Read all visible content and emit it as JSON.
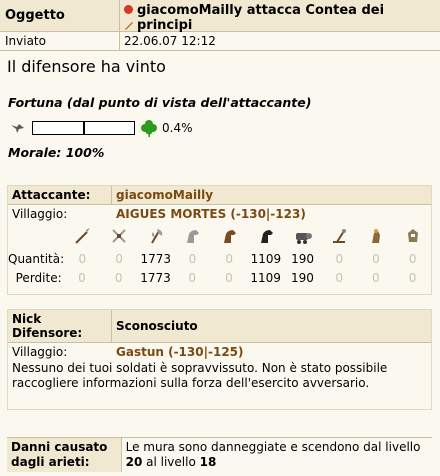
{
  "header": {
    "label_subject": "Oggetto",
    "subject": "giacomoMailly attacca Contea dei principi",
    "label_sent": "Inviato",
    "sent": "22.06.07 12:12"
  },
  "result_title": "Il difensore ha vinto",
  "fortune": {
    "title": "Fortuna (dal punto di vista dell'attaccante)",
    "value": 0.004,
    "percent_text": "0.4%"
  },
  "morale": "Morale: 100%",
  "attacker": {
    "label": "Attaccante:",
    "name": "giacomoMailly",
    "village_label": "Villaggio:",
    "village": "AIGUES MORTES (-130|-123)",
    "qty_label": "Quantità:",
    "losses_label": "Perdite:",
    "units": [
      "spear-icon",
      "sword-icon",
      "axe-icon",
      "scout-icon",
      "light-cavalry-icon",
      "heavy-cavalry-icon",
      "ram-icon",
      "catapult-icon",
      "snob-icon",
      "knight-icon"
    ],
    "quantities": [
      "0",
      "0",
      "1773",
      "0",
      "0",
      "1109",
      "190",
      "0",
      "0",
      "0"
    ],
    "losses": [
      "0",
      "0",
      "1773",
      "0",
      "0",
      "1109",
      "190",
      "0",
      "0",
      "0"
    ]
  },
  "defender": {
    "label": "Nick Difensore:",
    "name": "Sconosciuto",
    "village_label": "Villaggio:",
    "village": "Gastun (-130|-125)",
    "message": "Nessuno dei tuoi soldati è sopravvissuto. Non è stato possibile raccogliere informazioni sulla forza dell'esercito avversario."
  },
  "damage": {
    "label": "Danni causato dagli arieti:",
    "text_before": "Le mura sono danneggiate e scendono dal livello",
    "from_level": "20",
    "text_mid": "al livello",
    "to_level": "18"
  },
  "colors": {
    "accent": "#7a4a10",
    "header_bg": "#f0e8d0",
    "page_bg": "#fbf8ef"
  }
}
